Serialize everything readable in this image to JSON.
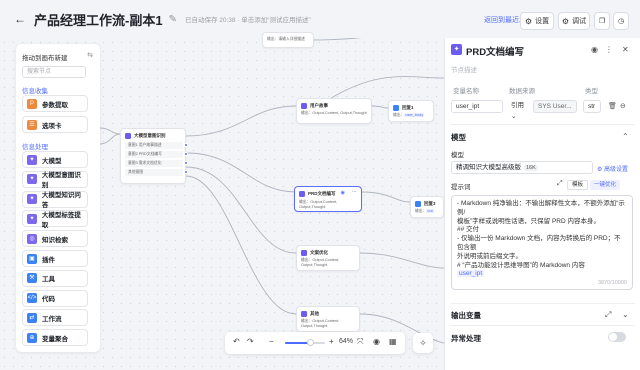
{
  "header": {
    "title": "产品经理工作流-副本1",
    "save_status": "已自动保存 20:38 · 单击添加“测试应用描述”",
    "version_link": "返回到最近发布版本",
    "settings_label": "设置",
    "debug_label": "调试"
  },
  "sidebar": {
    "heading": "拖动到画布新建",
    "search_placeholder": "搜索节点",
    "group1": "信息收集",
    "group2": "信息处理",
    "items_collect": [
      {
        "label": "参数提取",
        "color": "#f0883e",
        "icon": "P"
      },
      {
        "label": "选项卡",
        "color": "#f0883e",
        "icon": "☰"
      }
    ],
    "items_process": [
      {
        "label": "大模型",
        "color": "#7b68ee",
        "icon": "✦"
      },
      {
        "label": "大模型意图识别",
        "color": "#7b68ee",
        "icon": "✦"
      },
      {
        "label": "大模型知识问答",
        "color": "#7b68ee",
        "icon": "✦"
      },
      {
        "label": "大模型标签提取",
        "color": "#7b68ee",
        "icon": "✦"
      },
      {
        "label": "知识检索",
        "color": "#7b68ee",
        "icon": "◎"
      },
      {
        "label": "插件",
        "color": "#3b82f6",
        "icon": "▣"
      },
      {
        "label": "工具",
        "color": "#3b82f6",
        "icon": "⚒"
      },
      {
        "label": "代码",
        "color": "#3b82f6",
        "icon": "</>"
      },
      {
        "label": "工作流",
        "color": "#3b82f6",
        "icon": "⇄"
      },
      {
        "label": "变量聚合",
        "color": "#3b82f6",
        "icon": "⊕"
      }
    ]
  },
  "nodes": {
    "top_out": "输出：请输入详细描述",
    "user_story": {
      "title": "用户故事",
      "out": "输出：Output,Content, Output,Thought"
    },
    "reply1": {
      "title": "回复1",
      "out": "输出：",
      "tag": "user_body"
    },
    "intent": {
      "title": "大模型意图识别",
      "rows": [
        "意图1  用户故事描述",
        "意图2  PRD文档编写",
        "意图3  需求文档优化",
        "其他意图"
      ]
    },
    "prd": {
      "title": "PRD文档编写",
      "out": "输出：Output,Content, Output,Thought"
    },
    "reply3": {
      "title": "回复3",
      "out": "输出：",
      "tag": "out"
    },
    "doc_opt": {
      "title": "文案优化",
      "out": "输出：Output,Content, Output,Thought"
    },
    "other": {
      "title": "其他",
      "out": "输出：Output,Content, Output,Thought"
    }
  },
  "zoom": {
    "level": "64%",
    "fraction": 0.64
  },
  "panel": {
    "title": "PRD文档编写",
    "desc_placeholder": "节点描述",
    "col_name": "变量名称",
    "col_source": "数据来源",
    "col_type": "类型",
    "var_name": "user_ipt",
    "var_ref": "引用",
    "var_source": "SYS User...",
    "var_type": "str",
    "model_section": "模型",
    "model_label": "模型",
    "model_value": "精调知识大模型高级版",
    "model_badge": "16K",
    "advanced": "高级设置",
    "prompt_label": "提示词",
    "template_btn": "模板",
    "optimize_btn": "一键优化",
    "prompt_lines": [
      "- Markdown 纯净输出：不输出解释性文本，不额外添加“示例/",
      "模板”字样或说明性话语，只保留 PRD 内容本身。",
      "",
      "## 交付",
      "- 仅输出一份 Markdown 文档，内容为转换后的 PRD；不包含额",
      "外说明或前后缀文字。",
      "# “产品功能设计思维导图”的 Markdown 内容"
    ],
    "prompt_tag": "user_ipt",
    "prompt_count": "3870/10000",
    "output_section": "输出变量",
    "exception_section": "异常处理"
  }
}
